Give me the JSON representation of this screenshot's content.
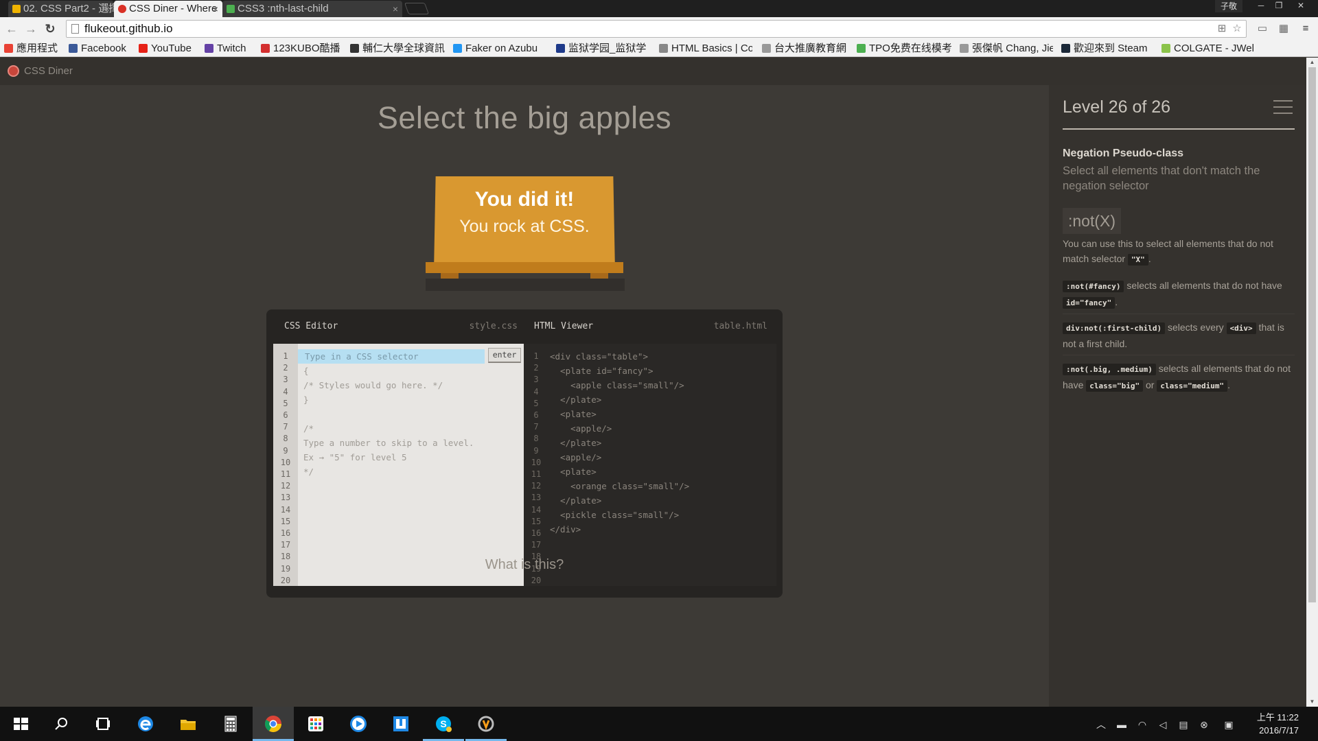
{
  "browser": {
    "tabs": [
      {
        "title": "02. CSS Part2 - 選擇",
        "favicon_color": "#f0b400",
        "active": false
      },
      {
        "title": "CSS Diner - Where",
        "favicon_color": "#d93025",
        "active": true
      },
      {
        "title": "CSS3 :nth-last-child",
        "favicon_color": "#4caf50",
        "active": false
      }
    ],
    "tab_close": "×",
    "window_user": "子敬",
    "window_controls": {
      "minimize": "─",
      "restore": "❐",
      "close": "✕"
    },
    "url": "flukeout.github.io",
    "nav": {
      "back": "←",
      "forward": "→",
      "reload": "↻"
    },
    "bookmarks": [
      {
        "label": "應用程式",
        "color": "#e94235"
      },
      {
        "label": "Facebook",
        "color": "#3b5998"
      },
      {
        "label": "YouTube",
        "color": "#e62117"
      },
      {
        "label": "Twitch",
        "color": "#6441a5"
      },
      {
        "label": "123KUBO酷播",
        "color": "#d32f2f"
      },
      {
        "label": "輔仁大學全球資訊",
        "color": "#333333"
      },
      {
        "label": "Faker on Azubu",
        "color": "#2196f3"
      },
      {
        "label": "监狱学园_监狱学",
        "color": "#1e3a8a"
      },
      {
        "label": "HTML Basics | Co",
        "color": "#888888"
      },
      {
        "label": "台大推廣教育網",
        "color": "#999999"
      },
      {
        "label": "TPO免费在线模考",
        "color": "#4caf50"
      },
      {
        "label": "張傑帆 Chang, Jie",
        "color": "#999999"
      },
      {
        "label": "歡迎來到 Steam",
        "color": "#1b2838"
      },
      {
        "label": "COLGATE - JWel",
        "color": "#8bc34a"
      }
    ]
  },
  "site": {
    "logo_text": "CSS Diner",
    "title": "Select the big apples",
    "win_line1": "You did it!",
    "win_line2": "You rock at CSS.",
    "what_is": "What is this?"
  },
  "editor": {
    "css_title": "CSS Editor",
    "css_file": "style.css",
    "html_title": "HTML Viewer",
    "html_file": "table.html",
    "input_placeholder": "Type in a CSS selector",
    "enter_label": "enter",
    "css_lines": [
      "{",
      "/* Styles would go here. */",
      "}",
      "",
      "/*",
      "Type a number to skip to a level.",
      "Ex → \"5\" for level 5",
      "*/"
    ],
    "html_lines": [
      "<div class=\"table\">",
      "  <plate id=\"fancy\">",
      "    <apple class=\"small\"/>",
      "  </plate>",
      "  <plate>",
      "    <apple/>",
      "  </plate>",
      "  <apple/>",
      "  <plate>",
      "    <orange class=\"small\"/>",
      "  </plate>",
      "  <pickle class=\"small\"/>",
      "</div>"
    ],
    "line_count": 20
  },
  "sidebar": {
    "level_title": "Level 26 of 26",
    "progress": 1.0,
    "selector_name": "Negation Pseudo-class",
    "selector_title": "Select all elements that don't match the negation selector",
    "syntax": ":not(X)",
    "hint_pre": "You can use this to select all elements that do not match selector ",
    "hint_code": "\"X\"",
    "hint_post": ".",
    "examples": [
      {
        "code": ":not(#fancy)",
        "text1": " selects all elements that do not have ",
        "code2": "id=\"fancy\"",
        "text2": ".",
        "code3": "",
        "text3": ""
      },
      {
        "code": "div:not(:first-child)",
        "text1": " selects every ",
        "code2": "<div>",
        "text2": " that is not a first child.",
        "code3": "",
        "text3": ""
      },
      {
        "code": ":not(.big, .medium)",
        "text1": " selects all elements that do not have ",
        "code2": "class=\"big\"",
        "text2": " or ",
        "code3": "class=\"medium\"",
        "text3": "."
      }
    ]
  },
  "taskbar": {
    "apps": [
      {
        "name": "start",
        "color": "#ffffff"
      },
      {
        "name": "search",
        "color": "#ffffff"
      },
      {
        "name": "task-view",
        "color": "#ffffff"
      },
      {
        "name": "edge",
        "color": "#1e88e5"
      },
      {
        "name": "file-explorer",
        "color": "#f4c430"
      },
      {
        "name": "calculator",
        "color": "#ffffff"
      },
      {
        "name": "chrome",
        "color": "#db4437"
      },
      {
        "name": "apps-launcher",
        "color": "#e53935"
      },
      {
        "name": "media-player",
        "color": "#1e88e5"
      },
      {
        "name": "app-box",
        "color": "#1e88e5"
      },
      {
        "name": "skype",
        "color": "#00aff0"
      },
      {
        "name": "overwatch",
        "color": "#bbbbbb"
      }
    ],
    "time": "上午 11:22",
    "date": "2016/7/17"
  }
}
